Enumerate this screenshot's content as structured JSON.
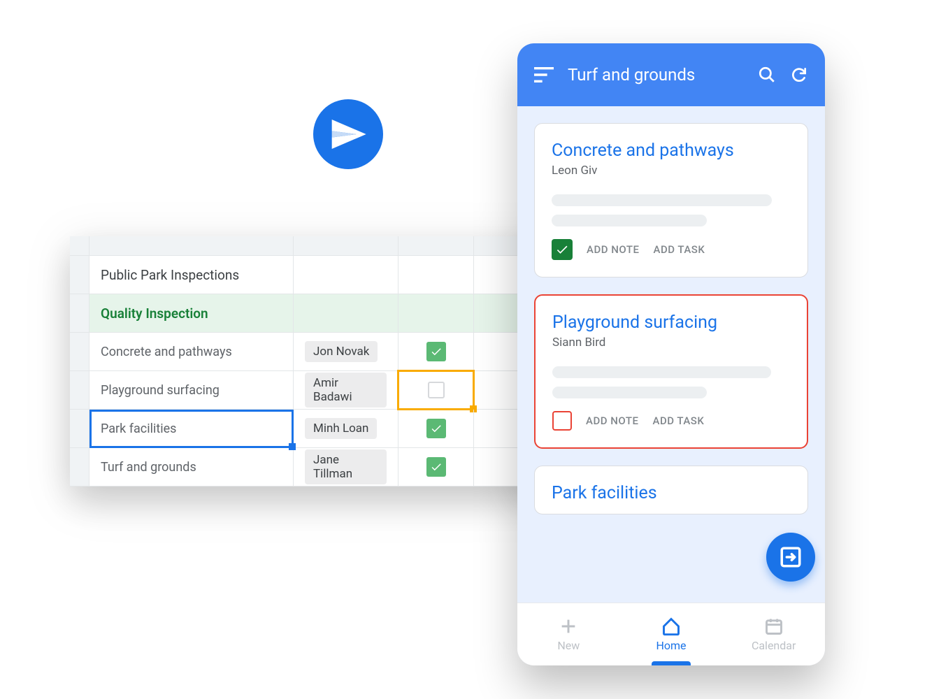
{
  "spreadsheet": {
    "title": "Public Park Inspections",
    "section": "Quality Inspection",
    "rows": [
      {
        "task": "Concrete and pathways",
        "assignee": "Jon Novak",
        "checked": true
      },
      {
        "task": "Playground surfacing",
        "assignee": "Amir Badawi",
        "checked": false
      },
      {
        "task": "Park facilities",
        "assignee": "Minh Loan",
        "checked": true
      },
      {
        "task": "Turf and grounds",
        "assignee": "Jane Tillman",
        "checked": true
      }
    ]
  },
  "mobile": {
    "appbar_title": "Turf and grounds",
    "cards": [
      {
        "title": "Concrete and pathways",
        "assignee": "Leon Giv",
        "checked": true,
        "style": "green"
      },
      {
        "title": "Playground surfacing",
        "assignee": "Siann Bird",
        "checked": false,
        "style": "red"
      },
      {
        "title": "Park facilities",
        "assignee": "",
        "checked": false,
        "style": "cut"
      }
    ],
    "actions": {
      "note": "ADD NOTE",
      "task": "ADD TASK"
    },
    "nav": {
      "new": "New",
      "home": "Home",
      "calendar": "Calendar"
    }
  }
}
